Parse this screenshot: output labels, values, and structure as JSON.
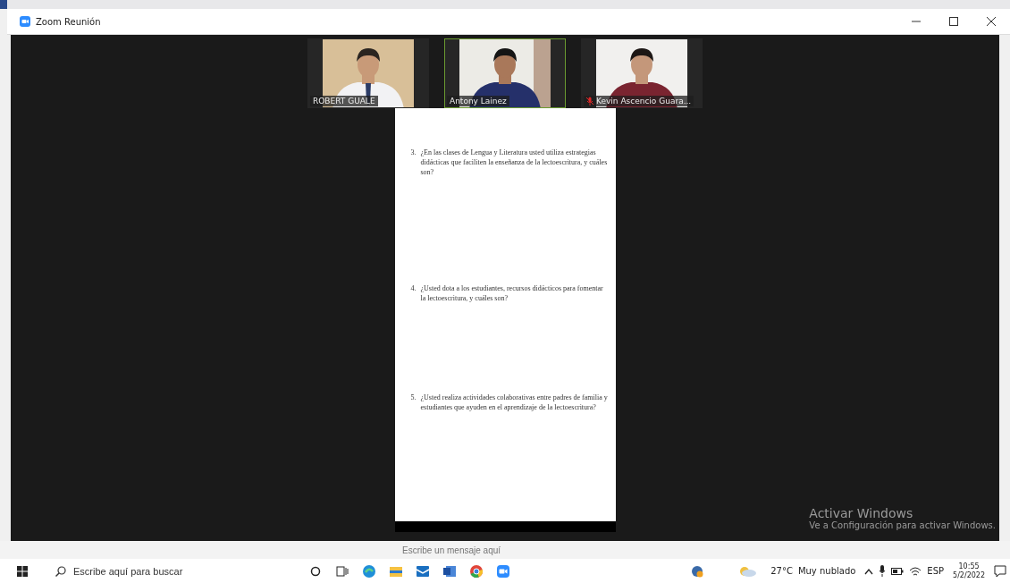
{
  "window": {
    "title": "Zoom Reunión"
  },
  "participants": [
    {
      "name": "ROBERT GUALE",
      "selected": false,
      "muted": false,
      "kind": "picture"
    },
    {
      "name": "Antony Lainez",
      "selected": true,
      "muted": false,
      "kind": "picture"
    },
    {
      "name": "Kevin Ascencio Guara...",
      "selected": false,
      "muted": true,
      "kind": "picture"
    }
  ],
  "document": {
    "questions": [
      {
        "number": "3.",
        "text": "¿En las clases de Lengua y Literatura usted utiliza estrategias didácticas que faciliten la enseñanza de la lectoescritura, y cuáles son?"
      },
      {
        "number": "4.",
        "text": "¿Usted dota a los estudiantes, recursos didácticos para fomentar la lectoescritura, y cuáles son?"
      },
      {
        "number": "5.",
        "text": "¿Usted realiza actividades colaborativas entre padres de familia y estudiantes que ayuden en el aprendizaje de la lectoescritura?"
      }
    ]
  },
  "chat_input": {
    "placeholder": "Escribe un mensaje aquí"
  },
  "activation_notice": {
    "title": "Activar Windows",
    "text": "Ve a Configuración para activar Windows."
  },
  "taskbar": {
    "search": {
      "placeholder": "Escribe aquí para buscar"
    },
    "temperature": "27°C",
    "weather": "Muy nublado",
    "language": "ESP",
    "time": "10:55",
    "date": "5/2/2022"
  }
}
